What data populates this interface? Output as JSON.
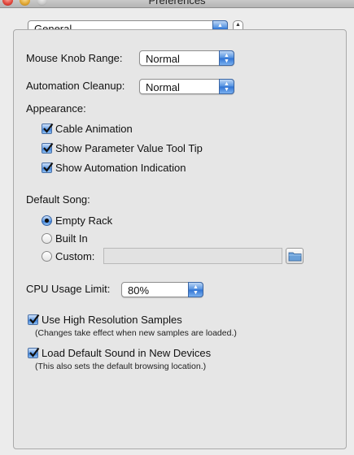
{
  "window": {
    "title": "Preferences"
  },
  "category_popup": {
    "value": "General"
  },
  "mouse_knob": {
    "label": "Mouse Knob Range:",
    "value": "Normal"
  },
  "automation_cleanup": {
    "label": "Automation Cleanup:",
    "value": "Normal"
  },
  "appearance": {
    "heading": "Appearance:",
    "options": [
      {
        "label": "Cable Animation",
        "checked": true
      },
      {
        "label": "Show Parameter Value Tool Tip",
        "checked": true
      },
      {
        "label": "Show Automation Indication",
        "checked": true
      }
    ]
  },
  "default_song": {
    "heading": "Default Song:",
    "options": [
      {
        "label": "Empty Rack",
        "selected": true
      },
      {
        "label": "Built In",
        "selected": false
      },
      {
        "label": "Custom:",
        "selected": false
      }
    ],
    "custom_path": ""
  },
  "cpu": {
    "label": "CPU Usage Limit:",
    "value": "80%"
  },
  "high_res": {
    "label": "Use High Resolution Samples",
    "checked": true,
    "note": "(Changes take effect when new samples are loaded.)"
  },
  "default_sound": {
    "label": "Load Default Sound in New Devices",
    "checked": true,
    "note": "(This also sets the default browsing location.)"
  },
  "icons": {
    "close": "close-icon",
    "minimize": "minimize-icon",
    "zoom": "zoom-icon",
    "popup_arrows": "up-down-arrows-icon",
    "checkmark": "checkmark-icon",
    "folder": "folder-icon"
  },
  "colors": {
    "accent": "#3b7fd8",
    "background": "#ececec"
  }
}
